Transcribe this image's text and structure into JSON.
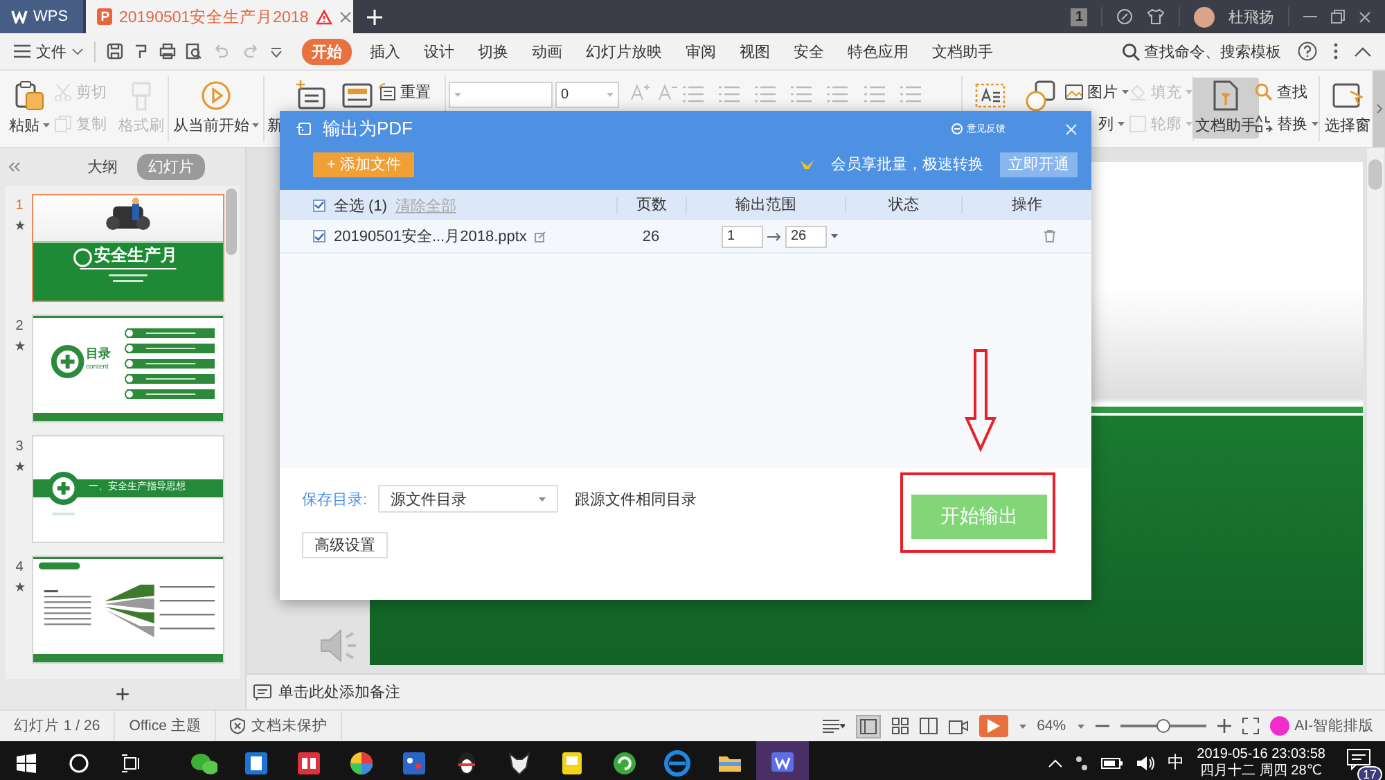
{
  "title_bar": {
    "app_tab": "WPS",
    "document_tab": "20190501安全生产月2018",
    "page_indicator": "1",
    "user_name": "杜飛扬"
  },
  "menu_bar": {
    "file_menu": "文件",
    "tabs": [
      {
        "label": "开始",
        "selected": true
      },
      {
        "label": "插入",
        "selected": false
      },
      {
        "label": "设计",
        "selected": false
      },
      {
        "label": "切换",
        "selected": false
      },
      {
        "label": "动画",
        "selected": false
      },
      {
        "label": "幻灯片放映",
        "selected": false
      },
      {
        "label": "审阅",
        "selected": false
      },
      {
        "label": "视图",
        "selected": false
      },
      {
        "label": "安全",
        "selected": false
      },
      {
        "label": "特色应用",
        "selected": false
      },
      {
        "label": "文档助手",
        "selected": false
      }
    ],
    "search": "查找命令、搜索模板"
  },
  "ribbon": {
    "columns": [
      {
        "kind": "large",
        "label": "粘贴",
        "dropdown": true,
        "disabled": false
      },
      {
        "kind": "stack",
        "items": [
          {
            "label": "剪切",
            "dropdown": false,
            "disabled": true
          },
          {
            "label": "复制",
            "dropdown": false,
            "disabled": true
          }
        ]
      },
      {
        "kind": "large",
        "label": "格式刷",
        "dropdown": false,
        "disabled": true
      },
      {
        "kind": "large",
        "label": "从当前开始",
        "dropdown": true,
        "disabled": false
      },
      {
        "kind": "large",
        "label": "新",
        "disabled": false
      },
      {
        "kind": "large",
        "disabled": false
      },
      {
        "kind": "stack",
        "items": [
          {
            "label": "重置",
            "dropdown": false,
            "disabled": false
          }
        ]
      },
      {
        "kind": "font",
        "font_size": "0"
      },
      {
        "kind": "paragraph"
      },
      {
        "kind": "large",
        "disabled": false
      },
      {
        "kind": "large",
        "disabled": false
      },
      {
        "kind": "stack",
        "items": [
          {
            "label": "图片",
            "dropdown": true,
            "disabled": false
          },
          {
            "label": "列",
            "dropdown": true,
            "disabled": false
          }
        ]
      },
      {
        "kind": "stack",
        "items": [
          {
            "label": "填充",
            "dropdown": true,
            "disabled": true
          },
          {
            "label": "轮廓",
            "dropdown": true,
            "disabled": true
          }
        ]
      },
      {
        "kind": "toggle",
        "label": "文档助手",
        "dropdown": false,
        "disabled": false
      },
      {
        "kind": "stack",
        "items": [
          {
            "label": "查找",
            "dropdown": false,
            "disabled": false
          },
          {
            "label": "替换",
            "dropdown": true,
            "disabled": false
          }
        ]
      },
      {
        "kind": "large",
        "label": "选择窗",
        "dropdown": false,
        "disabled": false
      }
    ]
  },
  "slides_panel": {
    "tabs": [
      {
        "label": "大纲",
        "selected": false
      },
      {
        "label": "幻灯片",
        "selected": true
      }
    ],
    "slides": [
      {
        "number": "1",
        "kind": "title",
        "title": "安全生产月",
        "selected": true
      },
      {
        "number": "2",
        "kind": "contents",
        "title": "目录",
        "subtitle": "content",
        "selected": false
      },
      {
        "number": "3",
        "kind": "section",
        "title": "一、安全生产指导思想",
        "selected": false
      },
      {
        "number": "4",
        "kind": "content",
        "selected": false
      }
    ],
    "add_slide": "+"
  },
  "editor": {
    "notes_placeholder": "单击此处添加备注"
  },
  "status_bar": {
    "slide_counter": "幻灯片 1 / 26",
    "theme": "Office 主题",
    "protection": "文档未保护",
    "zoom": "64%",
    "zoom_slider": {
      "level": 0.5
    },
    "ai_layout": "AI-智能排版"
  },
  "taskbar": {
    "input_method": "中",
    "time": "2019-05-16 23:03:58",
    "date": "四月十二 周四 28℃",
    "notification_count": "17"
  },
  "pdf_dialog": {
    "title": "输出为PDF",
    "feedback": "意见反馈",
    "add_file": "+ 添加文件",
    "promo": "会员享批量，极速转换",
    "upgrade": "立即开通",
    "table": {
      "select_all": {
        "label": "全选 (1)",
        "checked": true
      },
      "clear_all": "清除全部",
      "columns": [
        "页数",
        "输出范围",
        "状态",
        "操作"
      ],
      "rows": [
        {
          "checked": true,
          "file": "20190501安全...月2018.pptx",
          "pages": "26",
          "range_from": "1",
          "range_to": "26"
        }
      ]
    },
    "save_dir_label": "保存目录:",
    "save_dir": "源文件目录",
    "save_dir_hint": "跟源文件相同目录",
    "advanced": "高级设置",
    "start": "开始输出"
  }
}
